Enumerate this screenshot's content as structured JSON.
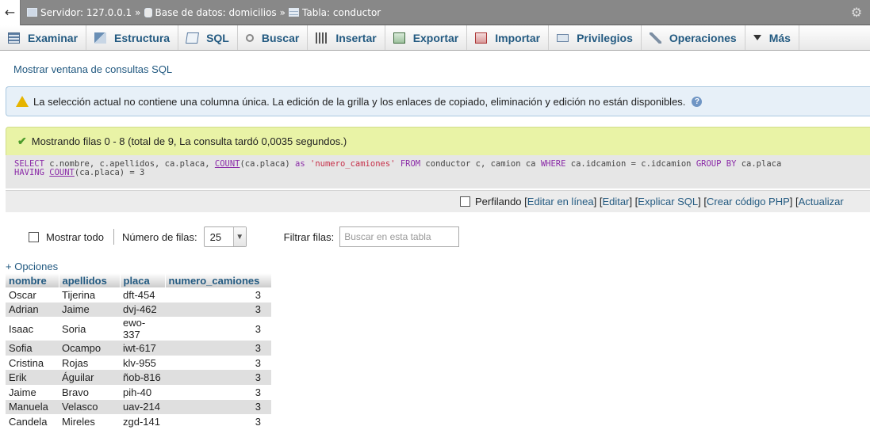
{
  "breadcrumb": {
    "server": "Servidor: 127.0.0.1",
    "database": "Base de datos: domicilios",
    "table": "Tabla: conductor",
    "separator": "»"
  },
  "tabs": [
    {
      "label": "Examinar",
      "icon": "browse-icon"
    },
    {
      "label": "Estructura",
      "icon": "structure-icon"
    },
    {
      "label": "SQL",
      "icon": "sql-icon"
    },
    {
      "label": "Buscar",
      "icon": "search-icon"
    },
    {
      "label": "Insertar",
      "icon": "insert-icon"
    },
    {
      "label": "Exportar",
      "icon": "export-icon"
    },
    {
      "label": "Importar",
      "icon": "import-icon"
    },
    {
      "label": "Privilegios",
      "icon": "privileges-icon"
    },
    {
      "label": "Operaciones",
      "icon": "operations-icon"
    },
    {
      "label": "Más",
      "icon": "more-icon"
    }
  ],
  "sql_window_link": "Mostrar ventana de consultas SQL",
  "notice": {
    "text": "La selección actual no contiene una columna única. La edición de la grilla y los enlaces de copiado, eliminación y edición no están disponibles."
  },
  "success": {
    "text": "Mostrando filas 0 - 8 (total de 9, La consulta tardó 0,0035 segundos.)"
  },
  "query": {
    "line1": "SELECT c.nombre, c.apellidos, ca.placa, COUNT(ca.placa) as 'numero_camiones' FROM conductor c, camion ca WHERE ca.idcamion = c.idcamion GROUP BY ca.placa",
    "line2": "HAVING COUNT(ca.placa) = 3"
  },
  "profiling": {
    "checkbox_label": "Perfilando",
    "links": [
      "Editar en línea",
      "Editar",
      "Explicar SQL",
      "Crear código PHP",
      "Actualizar"
    ]
  },
  "controls": {
    "show_all": "Mostrar todo",
    "rows_label": "Número de filas:",
    "rows_value": "25",
    "filter_label": "Filtrar filas:",
    "filter_placeholder": "Buscar en esta tabla"
  },
  "options_link": "+ Opciones",
  "results": {
    "columns": [
      "nombre",
      "apellidos",
      "placa",
      "numero_camiones"
    ],
    "rows": [
      [
        "Oscar",
        "Tijerina",
        "dft-454",
        "3"
      ],
      [
        "Adrian",
        "Jaime",
        "dvj-462",
        "3"
      ],
      [
        "Isaac",
        "Soria",
        "ewo-337",
        "3"
      ],
      [
        "Sofia",
        "Ocampo",
        "iwt-617",
        "3"
      ],
      [
        "Cristina",
        "Rojas",
        "klv-955",
        "3"
      ],
      [
        "Erik",
        "Águilar",
        "ñob-816",
        "3"
      ],
      [
        "Jaime",
        "Bravo",
        "pih-40",
        "3"
      ],
      [
        "Manuela",
        "Velasco",
        "uav-214",
        "3"
      ],
      [
        "Candela",
        "Mireles",
        "zgd-141",
        "3"
      ]
    ]
  }
}
